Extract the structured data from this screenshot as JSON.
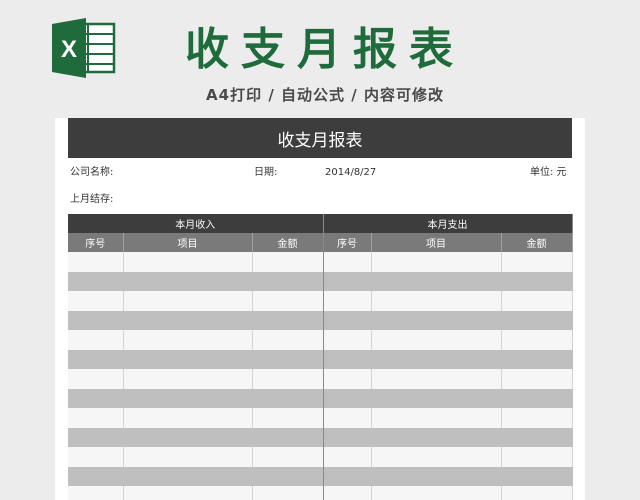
{
  "banner": {
    "title": "收支月报表",
    "subtitle": "A4打印 / 自动公式 / 内容可修改",
    "logo_icon": "excel-icon",
    "logo_letter": "X",
    "accent_color": "#1f6b3c"
  },
  "sheet": {
    "title": "收支月报表",
    "company_label": "公司名称:",
    "date_label": "日期:",
    "date_value": "2014/8/27",
    "unit_label": "单位: 元",
    "balance_label": "上月结存:"
  },
  "table": {
    "income_header": "本月收入",
    "expense_header": "本月支出",
    "columns": [
      "序号",
      "项目",
      "金额",
      "序号",
      "项目",
      "金额"
    ],
    "row_count": 13
  }
}
